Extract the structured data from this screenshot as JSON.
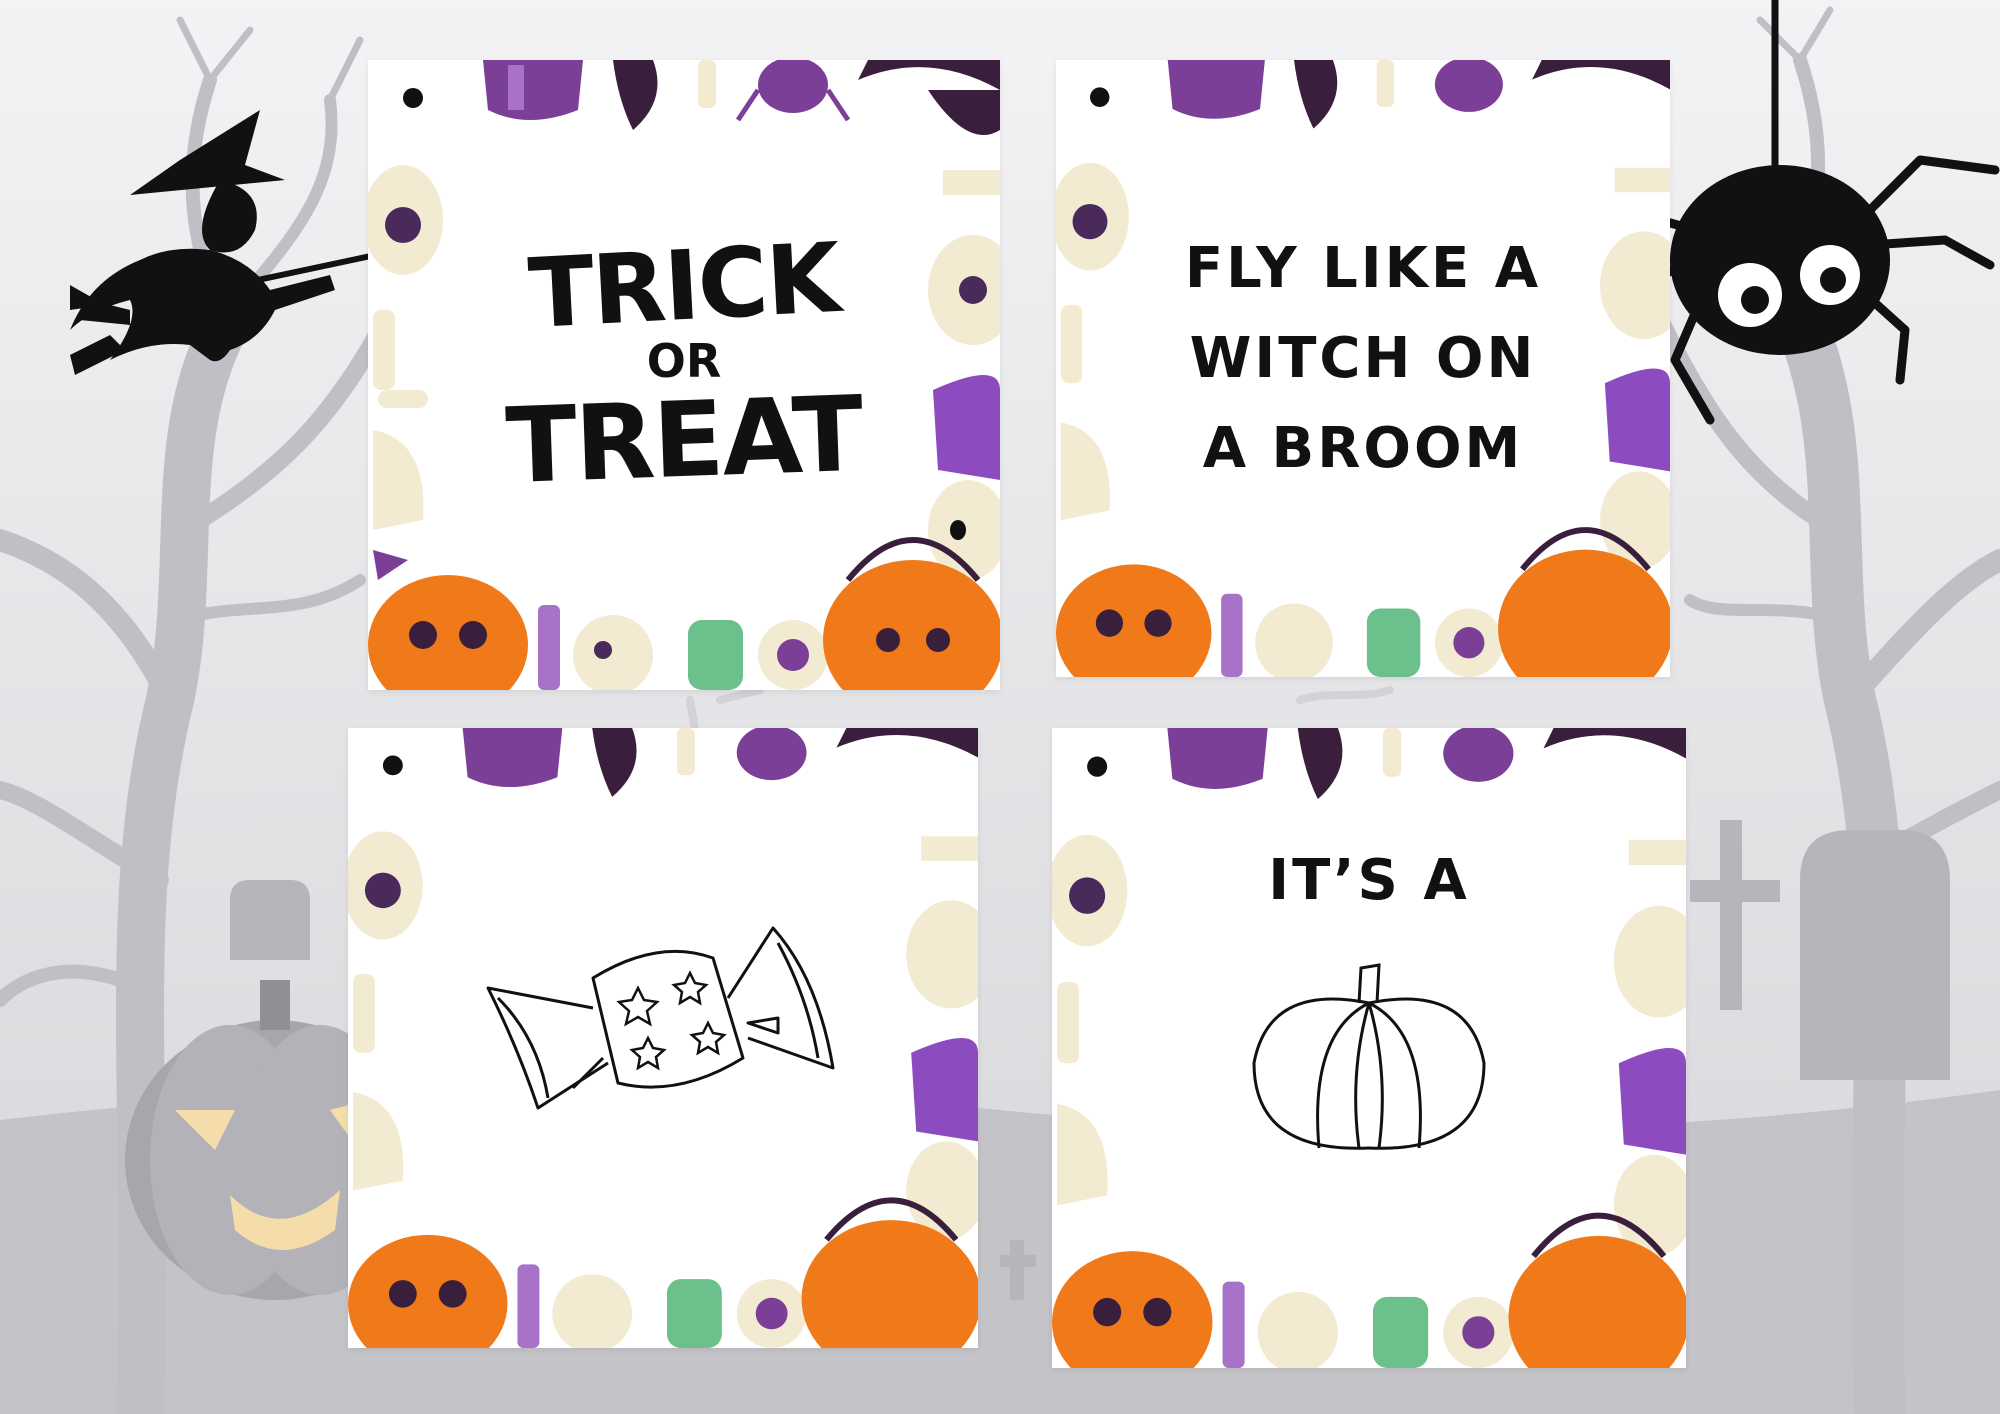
{
  "colors": {
    "background": "#ededef",
    "tree": "#c9c9cf",
    "pumpkin_orange": "#f07a1a",
    "purple": "#7b3f98",
    "dark_purple": "#3a1f3d",
    "bone": "#f3ead2",
    "zombie_green": "#6cc08b",
    "ink": "#111111"
  },
  "cards": [
    {
      "id": "card-1",
      "lines": [
        "TRICK",
        "OR",
        "TREAT"
      ]
    },
    {
      "id": "card-2",
      "lines": [
        "FLY LIKE A",
        "WITCH ON",
        "A BROOM"
      ]
    },
    {
      "id": "card-3",
      "icon": "wrapped-candy-icon"
    },
    {
      "id": "card-4",
      "lines": [
        "IT’S A"
      ],
      "icon": "pumpkin-outline-icon"
    }
  ],
  "decorations": {
    "left": "witch-on-broom-icon",
    "right": "hanging-spider-icon",
    "background": "jack-o-lantern-icon"
  }
}
